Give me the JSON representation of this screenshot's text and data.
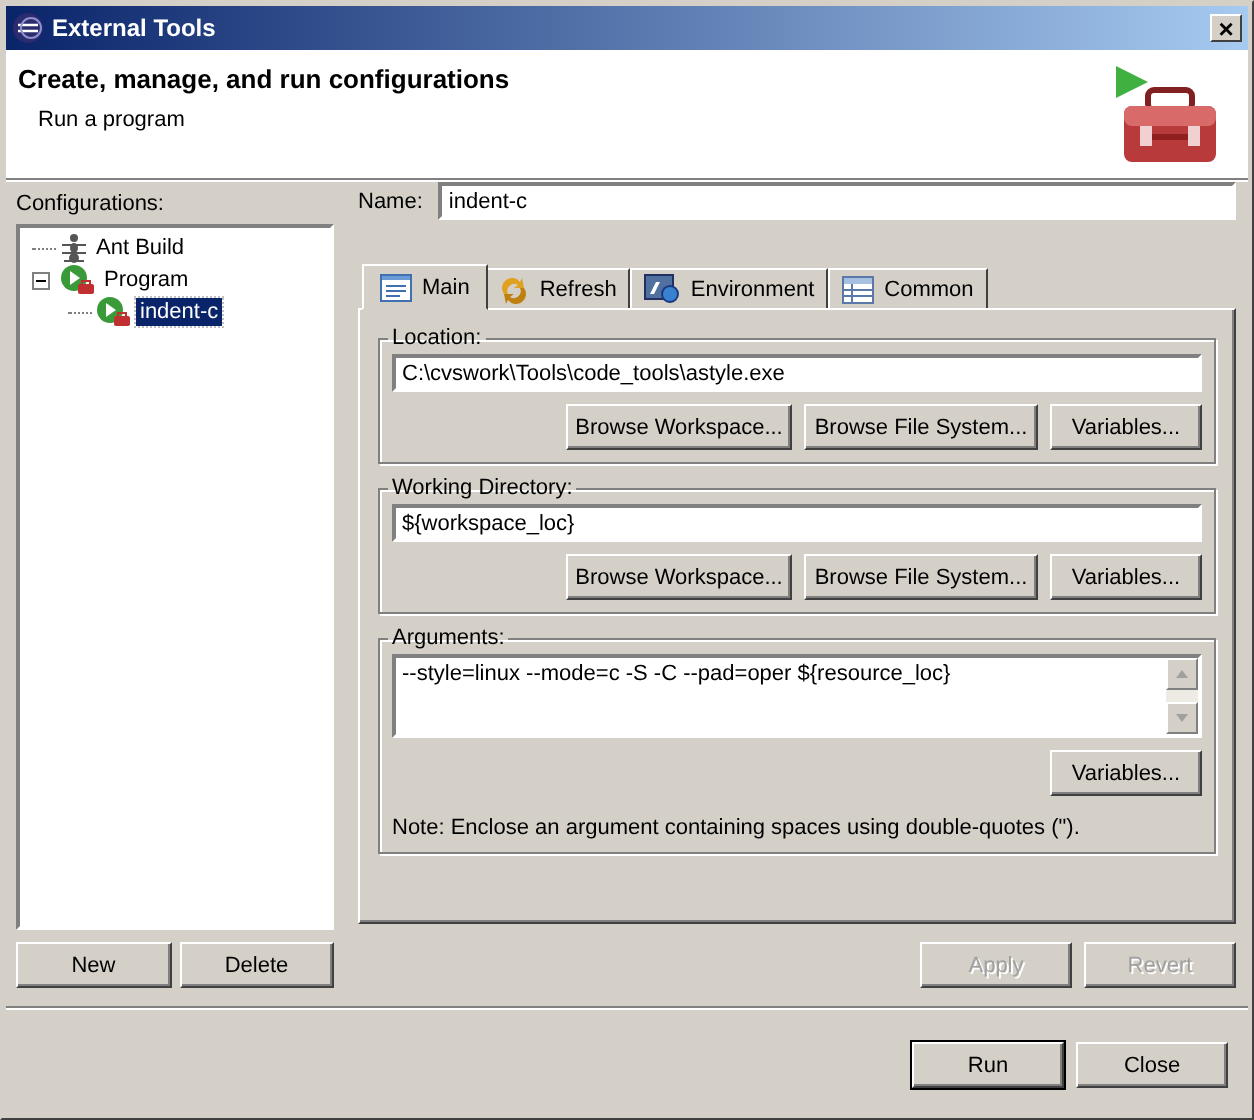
{
  "window": {
    "title": "External Tools",
    "close": "×"
  },
  "header": {
    "title": "Create, manage, and run configurations",
    "subtitle": "Run a program"
  },
  "configurations": {
    "label": "Configurations:",
    "tree": [
      {
        "label": "Ant Build",
        "kind": "ant",
        "selected": false
      },
      {
        "label": "Program",
        "kind": "program",
        "expanded": true,
        "selected": false,
        "children": [
          {
            "label": "indent-c",
            "kind": "config",
            "selected": true
          }
        ]
      }
    ],
    "buttons": [
      "New",
      "Delete"
    ]
  },
  "name": {
    "label": "Name:",
    "value": "indent-c"
  },
  "tabs": [
    {
      "label": "Main",
      "kind": "main",
      "selected": true
    },
    {
      "label": "Refresh",
      "kind": "refresh",
      "selected": false
    },
    {
      "label": "Environment",
      "kind": "environment",
      "selected": false
    },
    {
      "label": "Common",
      "kind": "common",
      "selected": false
    }
  ],
  "location": {
    "label": "Location:",
    "value": "C:\\cvswork\\Tools\\code_tools\\astyle.exe",
    "buttons": [
      "Browse Workspace...",
      "Browse File System...",
      "Variables..."
    ]
  },
  "working_directory": {
    "label": "Working Directory:",
    "value": "${workspace_loc}",
    "buttons": [
      "Browse Workspace...",
      "Browse File System...",
      "Variables..."
    ]
  },
  "arguments": {
    "label": "Arguments:",
    "value": "--style=linux --mode=c -S -C --pad=oper ${resource_loc}",
    "button": "Variables...",
    "note": "Note: Enclose an argument containing spaces using double-quotes (\")."
  },
  "edit_buttons": [
    {
      "label": "Apply",
      "disabled": true
    },
    {
      "label": "Revert",
      "disabled": true
    }
  ],
  "dialog_buttons": [
    {
      "label": "Run",
      "default": true
    },
    {
      "label": "Close",
      "default": false
    }
  ]
}
